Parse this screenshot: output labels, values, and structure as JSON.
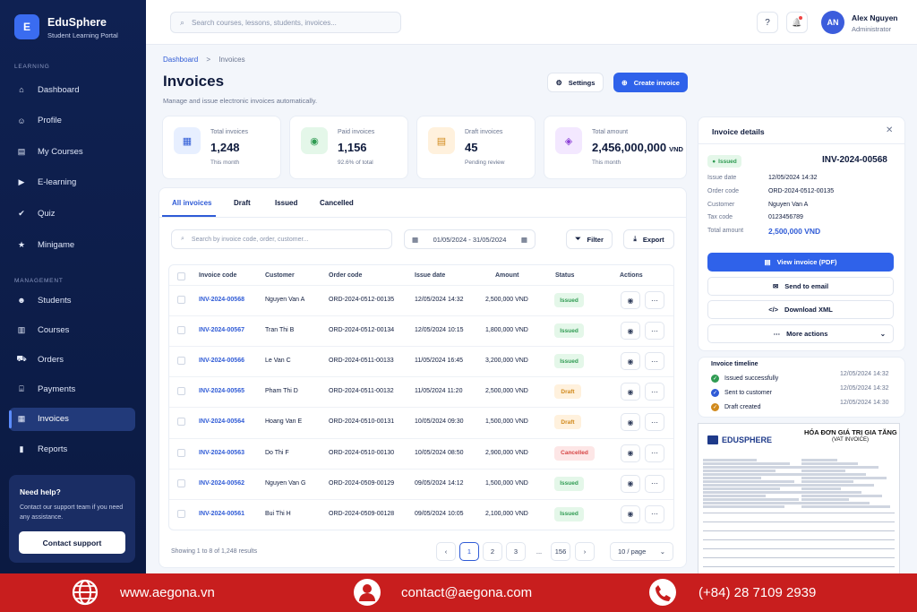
{
  "app": {
    "logo_letter": "E",
    "name": "EduSphere",
    "subtitle": "Student Learning Portal"
  },
  "sidebar": {
    "learning_label": "LEARNING",
    "management_label": "MANAGEMENT",
    "learning_items": [
      {
        "label": "Dashboard",
        "icon": "home-icon"
      },
      {
        "label": "Profile",
        "icon": "user-icon"
      },
      {
        "label": "My Courses",
        "icon": "book-icon"
      },
      {
        "label": "E-learning",
        "icon": "play-icon"
      },
      {
        "label": "Quiz",
        "icon": "check-icon"
      },
      {
        "label": "Minigame",
        "icon": "star-icon"
      }
    ],
    "management_items": [
      {
        "label": "Students",
        "icon": "users-icon"
      },
      {
        "label": "Courses",
        "icon": "book-open-icon"
      },
      {
        "label": "Orders",
        "icon": "cart-icon"
      },
      {
        "label": "Payments",
        "icon": "bank-icon"
      },
      {
        "label": "Invoices",
        "icon": "file-icon",
        "active": true
      },
      {
        "label": "Reports",
        "icon": "chart-icon"
      }
    ],
    "help": {
      "title": "Need help?",
      "desc": "Contact our support team if you need any assistance.",
      "button": "Contact support"
    }
  },
  "topbar": {
    "search_placeholder": "Search courses, lessons, students, invoices...",
    "help": "?",
    "bell": "🔔",
    "avatar": "AN",
    "user": "Alex Nguyen",
    "role": "Administrator"
  },
  "page": {
    "crumb_home": "Dashboard",
    "crumb_sep": ">",
    "crumb_current": "Invoices",
    "title": "Invoices",
    "subtitle": "Manage and issue electronic invoices automatically.",
    "settings": "Settings",
    "create": "Create invoice"
  },
  "stats": [
    {
      "label": "Total invoices",
      "value": "1,248",
      "unit": "",
      "sub": "This month",
      "color": "#e7efff",
      "icon_color": "#2f5bd6",
      "icon": "grid-icon"
    },
    {
      "label": "Paid invoices",
      "value": "1,156",
      "unit": "",
      "sub": "92.6% of total",
      "color": "#e4f7e9",
      "icon_color": "#2f9b52",
      "icon": "money-icon"
    },
    {
      "label": "Draft invoices",
      "value": "45",
      "unit": "",
      "sub": "Pending review",
      "color": "#fff1dd",
      "icon_color": "#d18a1d",
      "icon": "doc-icon"
    },
    {
      "label": "Total amount",
      "value": "2,456,000,000",
      "unit": "VND",
      "sub": "This month",
      "color": "#f3e8ff",
      "icon_color": "#8b3fd6",
      "icon": "wallet-icon"
    }
  ],
  "tabs": [
    "All invoices",
    "Draft",
    "Issued",
    "Cancelled"
  ],
  "filters": {
    "search_placeholder": "Search by invoice code, order, customer...",
    "date_range": "01/05/2024 - 31/05/2024",
    "filter": "Filter",
    "export": "Export"
  },
  "table": {
    "headers": [
      "Invoice code",
      "Customer",
      "Order code",
      "Issue date",
      "Amount",
      "Status",
      "Actions"
    ],
    "rows": [
      {
        "code": "INV-2024-00568",
        "customer": "Nguyen Van A",
        "order": "ORD-2024-0512-00135",
        "date": "12/05/2024 14:32",
        "amount": "2,500,000 VND",
        "status": "Issued"
      },
      {
        "code": "INV-2024-00567",
        "customer": "Tran Thi B",
        "order": "ORD-2024-0512-00134",
        "date": "12/05/2024 10:15",
        "amount": "1,800,000 VND",
        "status": "Issued"
      },
      {
        "code": "INV-2024-00566",
        "customer": "Le Van C",
        "order": "ORD-2024-0511-00133",
        "date": "11/05/2024 16:45",
        "amount": "3,200,000 VND",
        "status": "Issued"
      },
      {
        "code": "INV-2024-00565",
        "customer": "Pham Thi D",
        "order": "ORD-2024-0511-00132",
        "date": "11/05/2024 11:20",
        "amount": "2,500,000 VND",
        "status": "Draft"
      },
      {
        "code": "INV-2024-00564",
        "customer": "Hoang Van E",
        "order": "ORD-2024-0510-00131",
        "date": "10/05/2024 09:30",
        "amount": "1,500,000 VND",
        "status": "Draft"
      },
      {
        "code": "INV-2024-00563",
        "customer": "Do Thi F",
        "order": "ORD-2024-0510-00130",
        "date": "10/05/2024 08:50",
        "amount": "2,900,000 VND",
        "status": "Cancelled"
      },
      {
        "code": "INV-2024-00562",
        "customer": "Nguyen Van G",
        "order": "ORD-2024-0509-00129",
        "date": "09/05/2024 14:12",
        "amount": "1,500,000 VND",
        "status": "Issued"
      },
      {
        "code": "INV-2024-00561",
        "customer": "Bui Thi H",
        "order": "ORD-2024-0509-00128",
        "date": "09/05/2024 10:05",
        "amount": "2,100,000 VND",
        "status": "Issued"
      }
    ]
  },
  "pagination": {
    "showing": "Showing 1 to 8 of 1,248 results",
    "pages": [
      "‹",
      "1",
      "2",
      "3",
      "...",
      "156",
      "›"
    ],
    "per_page": "10 / page"
  },
  "detail": {
    "title": "Invoice details",
    "status": "Issued",
    "number": "INV-2024-00568",
    "fields": [
      {
        "k": "Issue date",
        "v": "12/05/2024 14:32"
      },
      {
        "k": "Order code",
        "v": "ORD-2024-0512-00135"
      },
      {
        "k": "Customer",
        "v": "Nguyen Van A"
      },
      {
        "k": "Tax code",
        "v": "0123456789"
      },
      {
        "k": "Total amount",
        "v": "2,500,000 VND"
      }
    ],
    "view": "View invoice (PDF)",
    "email": "Send to email",
    "xml": "Download XML",
    "more": "More actions"
  },
  "timeline": {
    "title": "Invoice timeline",
    "items": [
      {
        "label": "Issued successfully",
        "date": "12/05/2024 14:32",
        "color": "#2f9b52"
      },
      {
        "label": "Sent to customer",
        "date": "12/05/2024 14:32",
        "color": "#2f5bd6"
      },
      {
        "label": "Draft created",
        "date": "12/05/2024 14:30",
        "color": "#d18a1d"
      }
    ]
  },
  "document": {
    "brand": "EDUSPHERE",
    "title": "HÓA ĐƠN GIÁ TRỊ GIA TĂNG",
    "subtitle": "(VAT INVOICE)"
  },
  "footer": {
    "web": "www.aegona.vn",
    "email": "contact@aegona.com",
    "phone": "(+84) 28 7109 2939"
  }
}
